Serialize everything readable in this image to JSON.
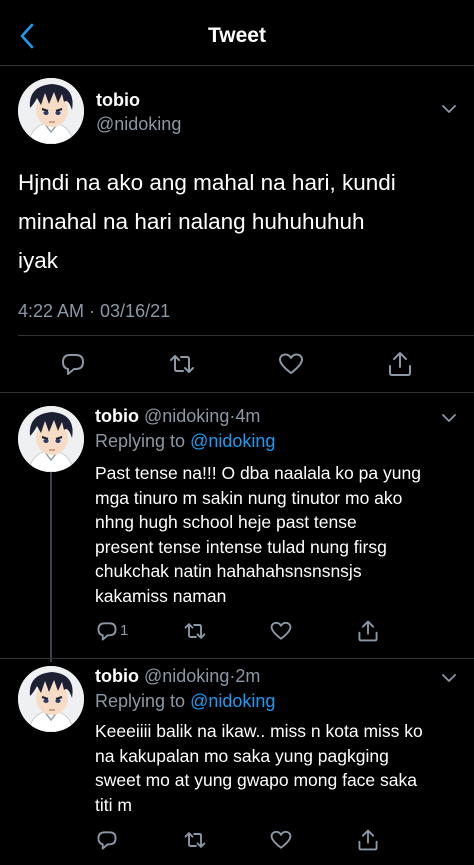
{
  "header": {
    "title": "Tweet"
  },
  "main_tweet": {
    "name": "tobio",
    "handle": "@nidoking",
    "text_lines": [
      "Hjndi na ako ang mahal na hari, kundi",
      "minahal na hari nalang huhuhuhuh",
      "iyak"
    ],
    "timestamp": "4:22 AM · 03/16/21"
  },
  "replies": [
    {
      "name": "tobio",
      "handle": "@nidoking",
      "dot": "·",
      "time": "4m",
      "replying_prefix": "Replying to",
      "replying_handle": "@nidoking",
      "text_lines": [
        "Past tense na!!! O dba naalala ko pa yung",
        "mga tinuro m sakin nung tinutor mo ako",
        "nhng hugh school heje past tense",
        "present tense intense tulad nung firsg",
        "chukchak natin hahahahsnsnsnsjs",
        "kakamiss naman"
      ],
      "reply_count": "1"
    },
    {
      "name": "tobio",
      "handle": "@nidoking",
      "dot": "·",
      "time": "2m",
      "replying_prefix": "Replying to",
      "replying_handle": "@nidoking",
      "text_lines": [
        "Keeeiiii balik na ikaw.. miss n kota miss ko",
        "na kakupalan mo saka yung pagkging",
        "sweet mo at yung gwapo mong face saka",
        "titi m"
      ]
    }
  ],
  "icons": {
    "back": "chevron-left-icon",
    "more": "chevron-down-icon",
    "reply": "speech-bubble-icon",
    "retweet": "retweet-icon",
    "like": "heart-icon",
    "share": "share-icon"
  },
  "colors": {
    "background": "#000000",
    "accent": "#1d9bf0",
    "text_primary": "#ffffff",
    "text_secondary": "#8b98a5",
    "divider": "#2f3336"
  }
}
